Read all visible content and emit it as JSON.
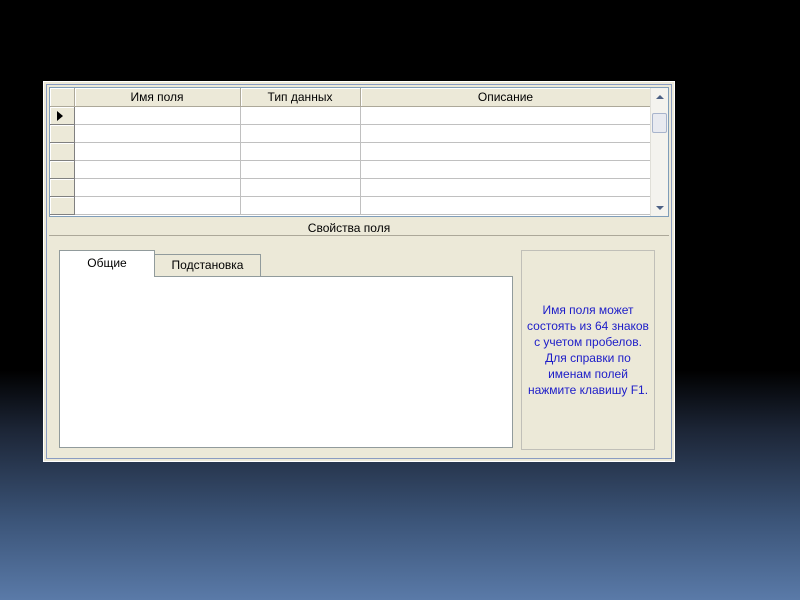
{
  "grid": {
    "columns": [
      {
        "label": "Имя поля"
      },
      {
        "label": "Тип данных"
      },
      {
        "label": "Описание"
      }
    ],
    "rows": [
      {
        "current": true
      },
      {
        "current": false
      },
      {
        "current": false
      },
      {
        "current": false
      },
      {
        "current": false
      },
      {
        "current": false
      }
    ]
  },
  "properties": {
    "title": "Свойства поля",
    "tabs": [
      {
        "label": "Общие",
        "active": true
      },
      {
        "label": "Подстановка",
        "active": false
      }
    ],
    "help_text": "Имя поля может состоять из 64 знаков с учетом пробелов.  Для справки по именам полей нажмите клавишу F1."
  },
  "colors": {
    "help_text": "#1c1cc8",
    "window_bg": "#ece9d8",
    "grid_bg": "#ffffff"
  },
  "icons": {
    "row_selector": "record-pointer-icon",
    "scroll_up": "scroll-up-arrow-icon",
    "scroll_down": "scroll-down-arrow-icon"
  }
}
